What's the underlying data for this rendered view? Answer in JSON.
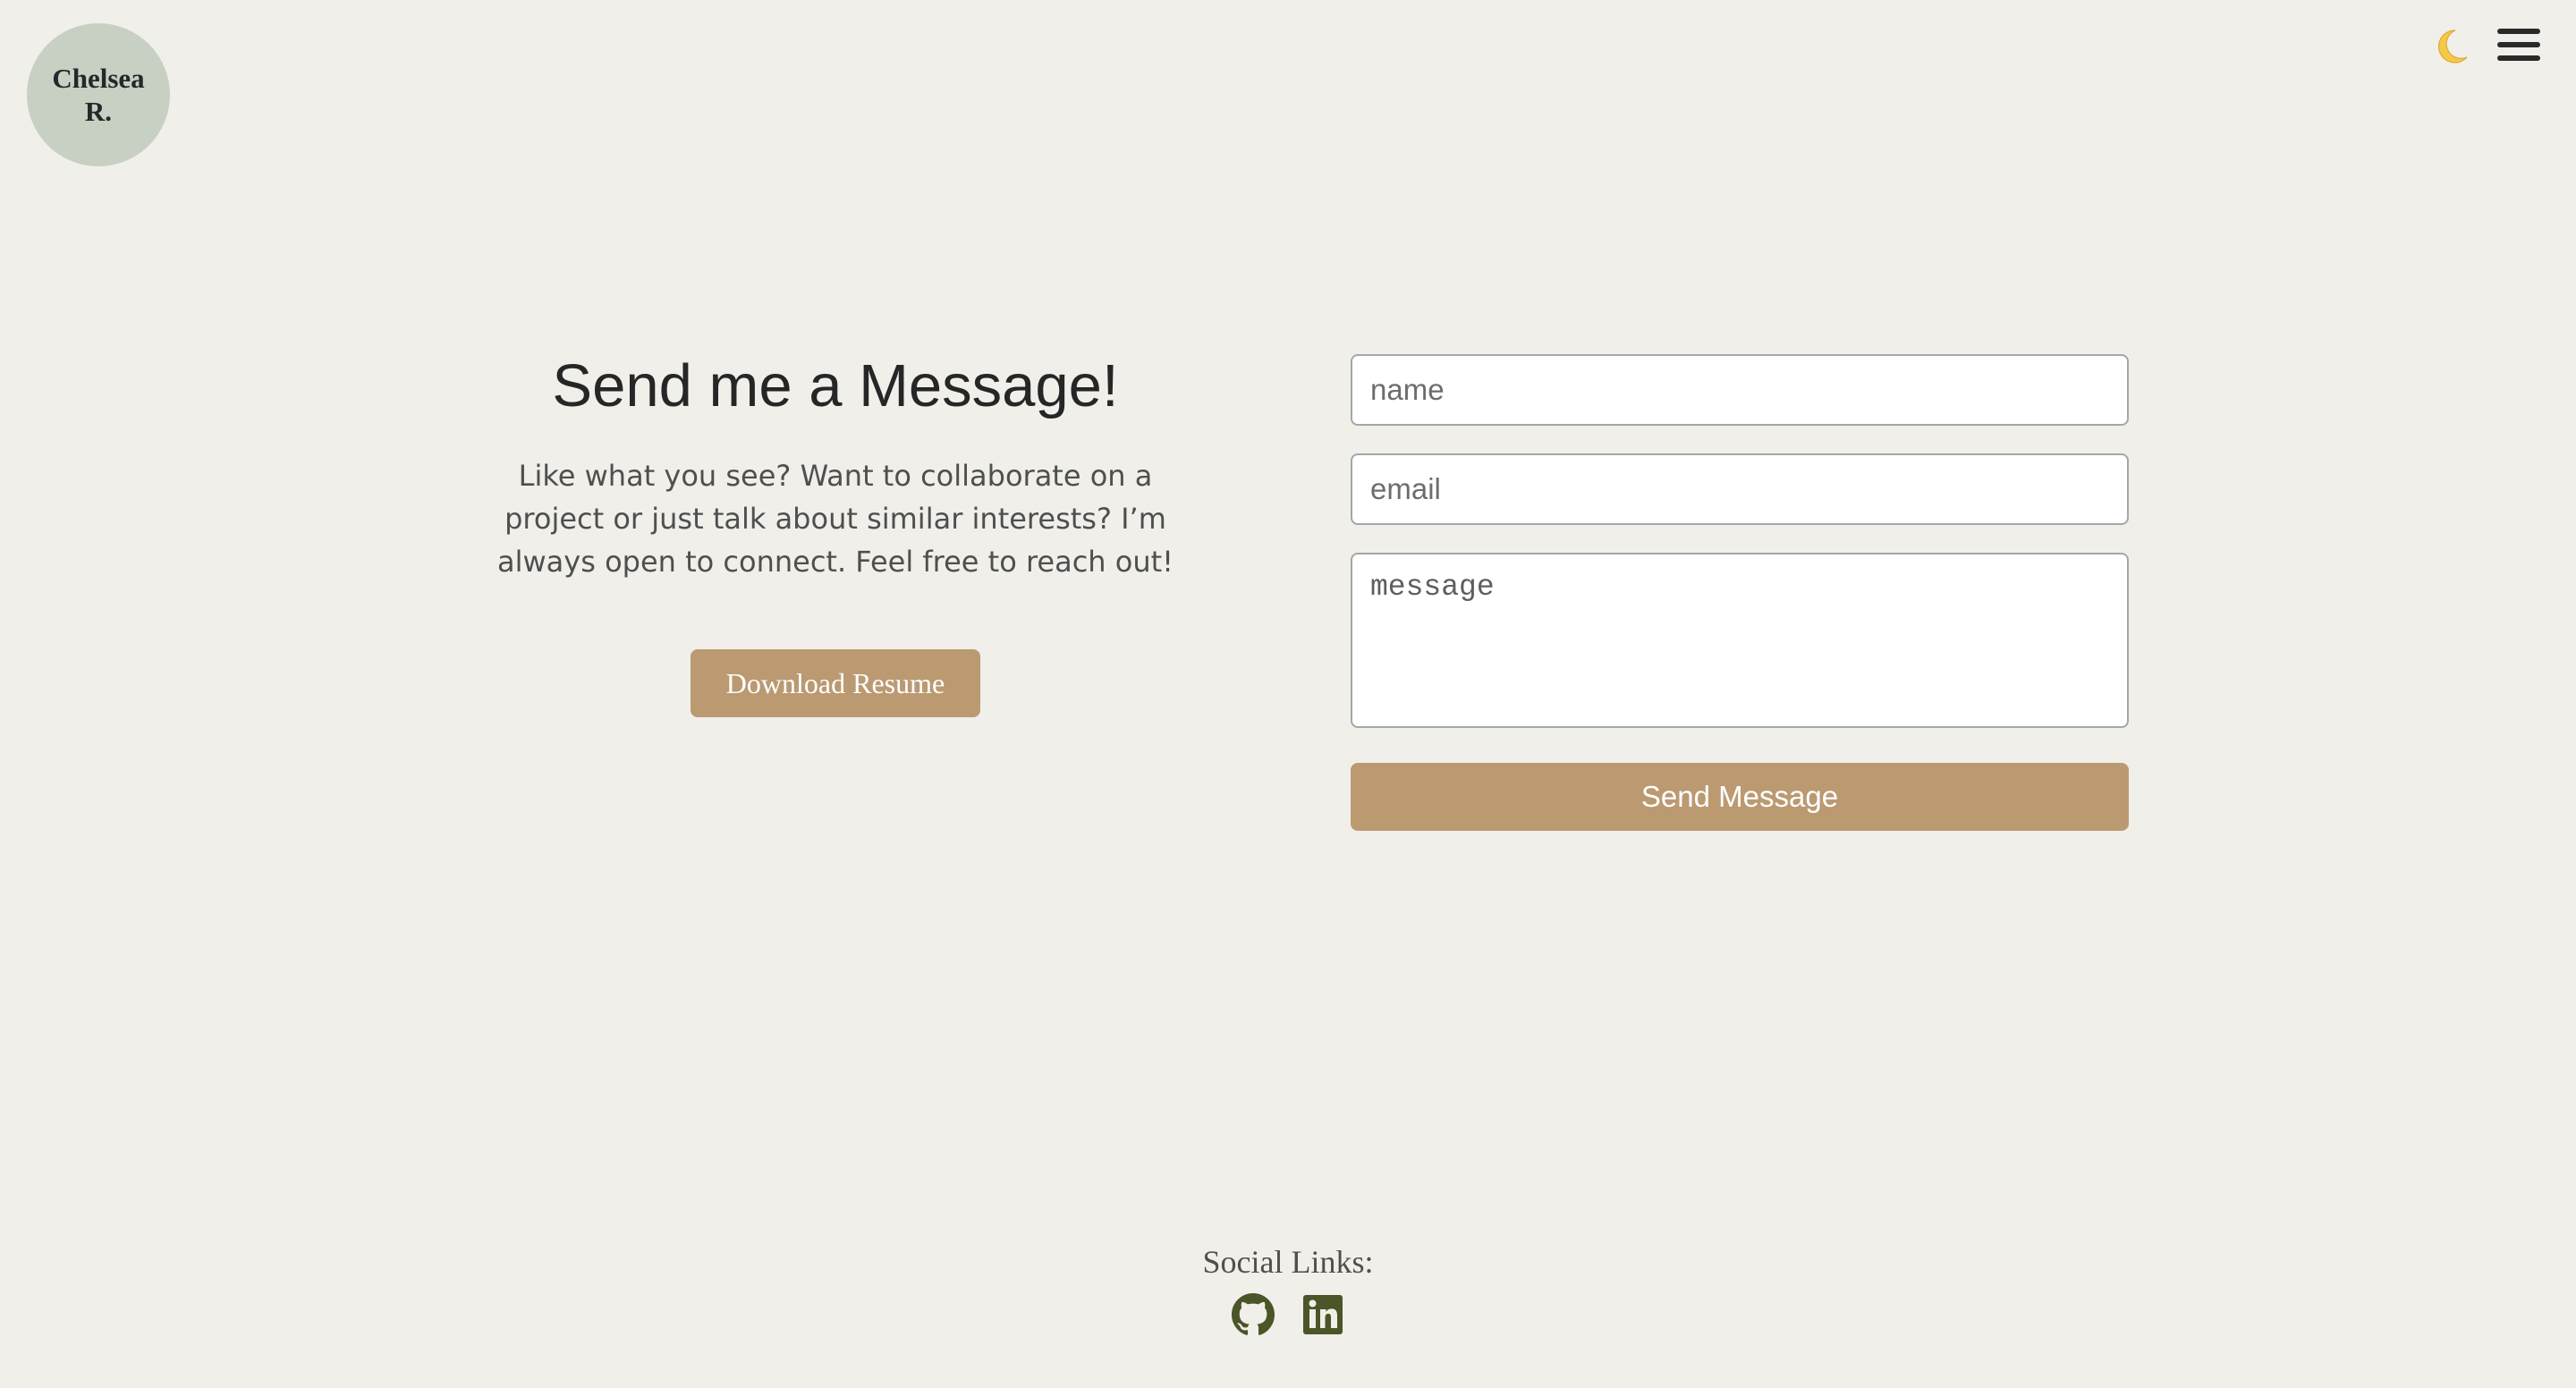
{
  "header": {
    "logo_line1": "Chelsea",
    "logo_line2": "R.",
    "theme_toggle_icon": "moon-icon",
    "menu_icon": "hamburger-menu-icon"
  },
  "intro": {
    "title": "Send me a Message!",
    "description": "Like what you see? Want to collaborate on a project or just talk about similar interests? I’m always open to connect. Feel free to reach out!",
    "resume_button": "Download Resume"
  },
  "form": {
    "name_placeholder": "name",
    "email_placeholder": "email",
    "message_placeholder": "message",
    "submit_label": "Send Message"
  },
  "footer": {
    "title": "Social Links:",
    "links": [
      {
        "icon": "github-icon"
      },
      {
        "icon": "linkedin-icon"
      }
    ]
  },
  "colors": {
    "background": "#f0efea",
    "logo_circle": "#c8cfc3",
    "accent_button": "#bb9a72",
    "social_icon": "#4a5528",
    "moon": "#f5c84a"
  }
}
